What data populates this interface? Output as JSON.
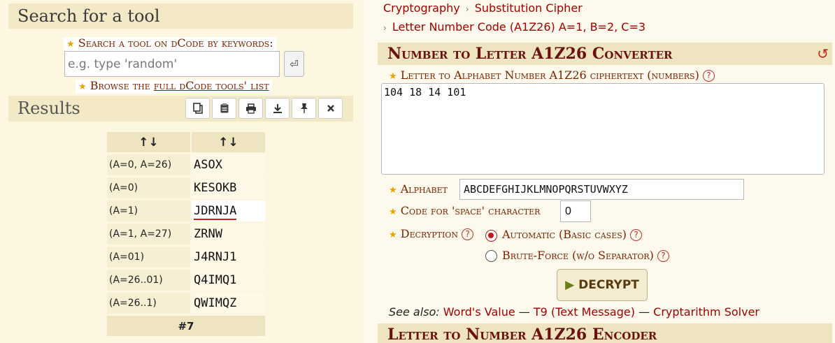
{
  "left": {
    "search_title": "Search for a tool",
    "keyword_label": "Search a tool on dCode by keywords:",
    "search_placeholder": "e.g. type 'random'",
    "search_button_icon": "enter-icon",
    "browse_prefix": "Browse the ",
    "browse_link": "full dCode tools' list",
    "results_title": "Results",
    "toolbar": [
      "copy-icon",
      "clipboard-icon",
      "print-icon",
      "download-icon",
      "pin-icon",
      "close-icon"
    ]
  },
  "results": {
    "headers": [
      "↑↓",
      "↑↓"
    ],
    "rows": [
      {
        "cond": "(A=0, A=26)",
        "value": "ASOX"
      },
      {
        "cond": "(A=0)",
        "value": "KESOKB"
      },
      {
        "cond": "(A=1)",
        "value": "JDRNJA"
      },
      {
        "cond": "(A=1, A=27)",
        "value": "ZRNW"
      },
      {
        "cond": "(A=01)",
        "value": "J4RNJ1"
      },
      {
        "cond": "(A=26..01)",
        "value": "Q4IMQ1"
      },
      {
        "cond": "(A=26..1)",
        "value": "QWIMQZ"
      }
    ],
    "footer": "#7"
  },
  "right": {
    "breadcrumb1": [
      "Cryptography",
      "Substitution Cipher"
    ],
    "breadcrumb2": "Letter Number Code (A1Z26) A=1, B=2, C=3",
    "converter_title": "Number to Letter A1Z26 Converter",
    "ciphertext_label": "Letter to Alphabet Number A1Z26 ciphertext (numbers)",
    "ciphertext_value": "104 18 14 101",
    "alphabet_label": "Alphabet",
    "alphabet_value": "ABCDEFGHIJKLMNOPQRSTUVWXYZ",
    "space_label": "Code for 'space' character",
    "space_value": "0",
    "decryption_label": "Decryption",
    "option_auto": "Automatic (Basic cases)",
    "option_brute": "Brute-Force (w/o Separator)",
    "decrypt_button": "DECRYPT",
    "see_also_label": "See also:",
    "see_also_links": [
      "Word's Value",
      "T9 (Text Message)",
      "Cryptarithm Solver"
    ],
    "see_also_sep": "—",
    "encoder_title": "Letter to Number A1Z26 Encoder"
  },
  "colors": {
    "accent": "#a30000",
    "header_bg": "#efe4c0",
    "star": "#e8a400"
  }
}
